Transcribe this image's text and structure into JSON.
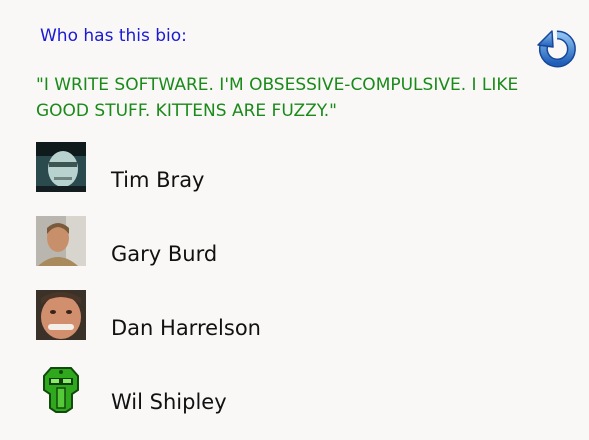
{
  "header": {
    "question": "Who has this bio:",
    "refresh_icon": "refresh-icon"
  },
  "bio": {
    "quote": "\"I WRITE SOFTWARE. I'M OBSESSIVE-COMPULSIVE. I LIKE GOOD STUFF. KITTENS ARE FUZZY.\""
  },
  "choices": [
    {
      "name": "Tim Bray",
      "avatar": "tim-bray-avatar"
    },
    {
      "name": "Gary Burd",
      "avatar": "gary-burd-avatar"
    },
    {
      "name": "Dan Harrelson",
      "avatar": "dan-harrelson-avatar"
    },
    {
      "name": "Wil Shipley",
      "avatar": "wil-shipley-avatar"
    }
  ],
  "colors": {
    "question": "#1a1ad4",
    "bio": "#1a8a1a",
    "background": "#f9f8f6",
    "refresh": "#2f6fc4"
  }
}
